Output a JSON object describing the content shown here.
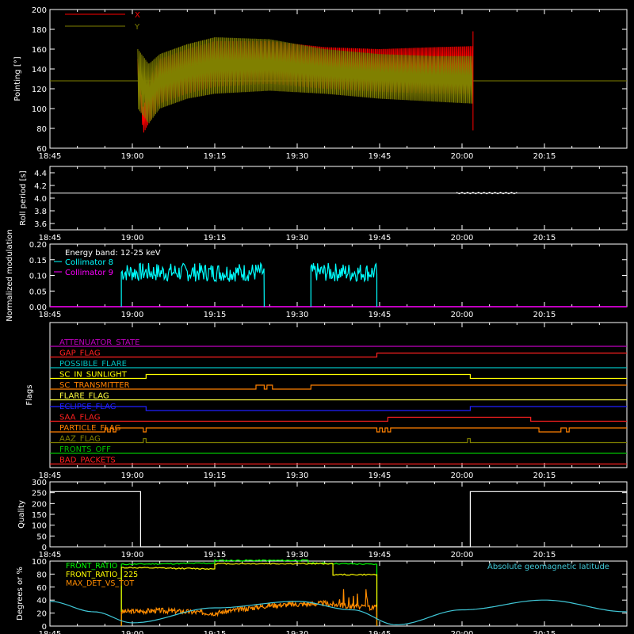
{
  "colors": {
    "background": "#000000",
    "axes": "#ffffff",
    "x_series": "#ff0000",
    "y_series": "#808000",
    "roll": "#ffffff",
    "coll8": "#00ffff",
    "coll9": "#ff00ff",
    "quality": "#ffffff",
    "front_ratio": "#00ff00",
    "front_ratio_225": "#ffff00",
    "max_det": "#ff8c00",
    "geomag": "#40c8d8"
  },
  "time_axis": {
    "start_min": 0,
    "end_min": 105,
    "tick_labels": [
      "18:45",
      "19:00",
      "19:15",
      "19:30",
      "19:45",
      "20:00",
      "20:15"
    ],
    "tick_values_min": [
      0,
      15,
      30,
      45,
      60,
      75,
      90
    ]
  },
  "chart_data": [
    {
      "type": "line",
      "title": "",
      "ylabel": "Pointing [°]",
      "ylim": [
        60,
        200
      ],
      "yticks": [
        "200",
        "180",
        "160",
        "140",
        "120",
        "100",
        "80",
        "60"
      ],
      "ytick_values": [
        200,
        180,
        160,
        140,
        120,
        100,
        80,
        60
      ],
      "legend": [
        "X",
        "Y"
      ],
      "series": [
        {
          "name": "X",
          "color": "#ff0000",
          "x": [
            16,
            17,
            18,
            20,
            25,
            30,
            40,
            50,
            60,
            70,
            77
          ],
          "upper": [
            150,
            100,
            130,
            150,
            160,
            168,
            168,
            162,
            160,
            162,
            163
          ],
          "lower": [
            128,
            75,
            85,
            105,
            115,
            122,
            125,
            120,
            117,
            115,
            115
          ]
        },
        {
          "name": "Y",
          "color": "#808000",
          "x": [
            16,
            18,
            20,
            25,
            30,
            40,
            50,
            60,
            70,
            77
          ],
          "upper": [
            160,
            145,
            155,
            165,
            172,
            170,
            160,
            155,
            153,
            153
          ],
          "lower": [
            100,
            85,
            100,
            110,
            115,
            118,
            115,
            110,
            107,
            105
          ],
          "baseline": 128
        }
      ]
    },
    {
      "type": "line",
      "ylabel": "Roll period [s]",
      "ylim": [
        3.5,
        4.5
      ],
      "yticks": [
        "4.4",
        "4.2",
        "4.0",
        "3.8",
        "3.6"
      ],
      "ytick_values": [
        4.4,
        4.2,
        4.0,
        3.8,
        3.6
      ],
      "x": [
        0,
        105
      ],
      "y": [
        4.08,
        4.08
      ]
    },
    {
      "type": "line",
      "ylabel": "Normalized modulation",
      "ylim": [
        0,
        0.2
      ],
      "yticks": [
        "0.20",
        "0.15",
        "0.10",
        "0.05",
        "0.00"
      ],
      "ytick_values": [
        0.2,
        0.15,
        0.1,
        0.05,
        0.0
      ],
      "annotation": "Energy band: 12-25 keV",
      "legend": [
        "Collimator 8",
        "Collimator 9"
      ],
      "segments": [
        {
          "start": 13,
          "end": 39,
          "mean": 0.11
        },
        {
          "start": 47.5,
          "end": 59.5,
          "mean": 0.11
        }
      ]
    },
    {
      "type": "line",
      "ylabel": "Flags",
      "flags": [
        {
          "name": "ATTENUATOR_STATE",
          "color": "#c000c0",
          "steps": [
            [
              0,
              0
            ],
            [
              105,
              0
            ]
          ]
        },
        {
          "name": "GAP_FLAG",
          "color": "#ff2020",
          "steps": [
            [
              0,
              0
            ],
            [
              59.5,
              1
            ],
            [
              105,
              1
            ]
          ]
        },
        {
          "name": "POSSIBLE_FLARE",
          "color": "#00c0c0",
          "steps": [
            [
              0,
              0
            ],
            [
              105,
              0
            ]
          ]
        },
        {
          "name": "SC_IN_SUNLIGHT",
          "color": "#ffff00",
          "steps": [
            [
              0,
              0
            ],
            [
              17.5,
              1
            ],
            [
              76.5,
              0
            ],
            [
              105,
              0
            ]
          ]
        },
        {
          "name": "SC_TRANSMITTER",
          "color": "#ff8000",
          "steps": [
            [
              0,
              0
            ],
            [
              37.5,
              1
            ],
            [
              39,
              0
            ],
            [
              39.5,
              1
            ],
            [
              40.5,
              0
            ],
            [
              47.5,
              1
            ],
            [
              105,
              1
            ]
          ]
        },
        {
          "name": "FLARE_FLAG",
          "color": "#ffff40",
          "steps": [
            [
              0,
              0
            ],
            [
              105,
              0
            ]
          ]
        },
        {
          "name": "ECLIPSE_FLAG",
          "color": "#2020ff",
          "steps": [
            [
              0,
              1
            ],
            [
              17.5,
              0
            ],
            [
              76.5,
              1
            ],
            [
              105,
              1
            ]
          ]
        },
        {
          "name": "SAA_FLAG",
          "color": "#ff2020",
          "steps": [
            [
              0,
              0
            ],
            [
              61.5,
              1
            ],
            [
              87.5,
              0
            ],
            [
              105,
              0
            ]
          ]
        },
        {
          "name": "PARTICLE_FLAG",
          "color": "#ff8000",
          "steps": [
            [
              0,
              0
            ],
            [
              10,
              1
            ],
            [
              10.5,
              0
            ],
            [
              11,
              1
            ],
            [
              11.5,
              0
            ],
            [
              12,
              1
            ],
            [
              17,
              0
            ],
            [
              17.5,
              1
            ],
            [
              59.5,
              0
            ],
            [
              60,
              1
            ],
            [
              60.5,
              0
            ],
            [
              61,
              1
            ],
            [
              61.5,
              0
            ],
            [
              62,
              1
            ],
            [
              89,
              0
            ],
            [
              93,
              1
            ],
            [
              94,
              0
            ],
            [
              94.5,
              1
            ],
            [
              105,
              1
            ]
          ]
        },
        {
          "name": "AAZ_FLAG",
          "color": "#808000",
          "steps": [
            [
              0,
              0
            ],
            [
              17,
              1
            ],
            [
              17.5,
              0
            ],
            [
              76,
              1
            ],
            [
              76.5,
              0
            ],
            [
              105,
              0
            ]
          ]
        },
        {
          "name": "FRONTS_OFF",
          "color": "#00c000",
          "steps": [
            [
              0,
              0
            ],
            [
              105,
              0
            ]
          ]
        },
        {
          "name": "BAD_PACKETS",
          "color": "#ff2020",
          "steps": [
            [
              0,
              0
            ],
            [
              105,
              0
            ]
          ]
        }
      ]
    },
    {
      "type": "line",
      "ylabel": "Quality",
      "ylim": [
        0,
        300
      ],
      "yticks": [
        "300",
        "250",
        "200",
        "150",
        "100",
        "50",
        "0"
      ],
      "ytick_values": [
        300,
        250,
        200,
        150,
        100,
        50,
        0
      ],
      "x": [
        0,
        16.5,
        16.5,
        76.5,
        76.5,
        105
      ],
      "y": [
        255,
        255,
        0,
        0,
        255,
        255
      ]
    },
    {
      "type": "line",
      "ylabel": "Degrees or %",
      "ylim": [
        0,
        100
      ],
      "yticks": [
        "100",
        "80",
        "60",
        "40",
        "20",
        "0"
      ],
      "ytick_values": [
        100,
        80,
        60,
        40,
        20,
        0
      ],
      "legend": [
        "FRONT_RATIO",
        "FRONT_RATIO_ 225",
        "MAX_DET_VS_TOT"
      ],
      "annotation": "Absolute geomagnetic latitude",
      "series": [
        {
          "name": "FRONT_RATIO",
          "color": "#00ff00",
          "x": [
            13,
            13,
            30,
            30,
            47,
            47,
            59.5,
            59.5
          ],
          "y": [
            0,
            95,
            97,
            101,
            101,
            97,
            95,
            0
          ]
        },
        {
          "name": "FRONT_RATIO_ 225",
          "color": "#ffff00",
          "x": [
            13,
            13,
            30,
            30,
            51.5,
            51.5,
            59.5,
            59.5
          ],
          "y": [
            0,
            90,
            88,
            96,
            96,
            79,
            79,
            0
          ]
        },
        {
          "name": "MAX_DET_VS_TOT",
          "color": "#ff8c00",
          "x": [
            13,
            13,
            20,
            30,
            40,
            50,
            55,
            59.5,
            59.5
          ],
          "y": [
            0,
            22,
            24,
            20,
            32,
            35,
            30,
            28,
            0
          ]
        },
        {
          "name": "Absolute geomagnetic latitude",
          "color": "#40c8d8",
          "x": [
            0,
            8,
            15,
            30,
            45,
            55,
            63,
            75,
            90,
            105
          ],
          "y": [
            38,
            22,
            5,
            28,
            38,
            25,
            2,
            25,
            40,
            22
          ]
        }
      ]
    }
  ]
}
